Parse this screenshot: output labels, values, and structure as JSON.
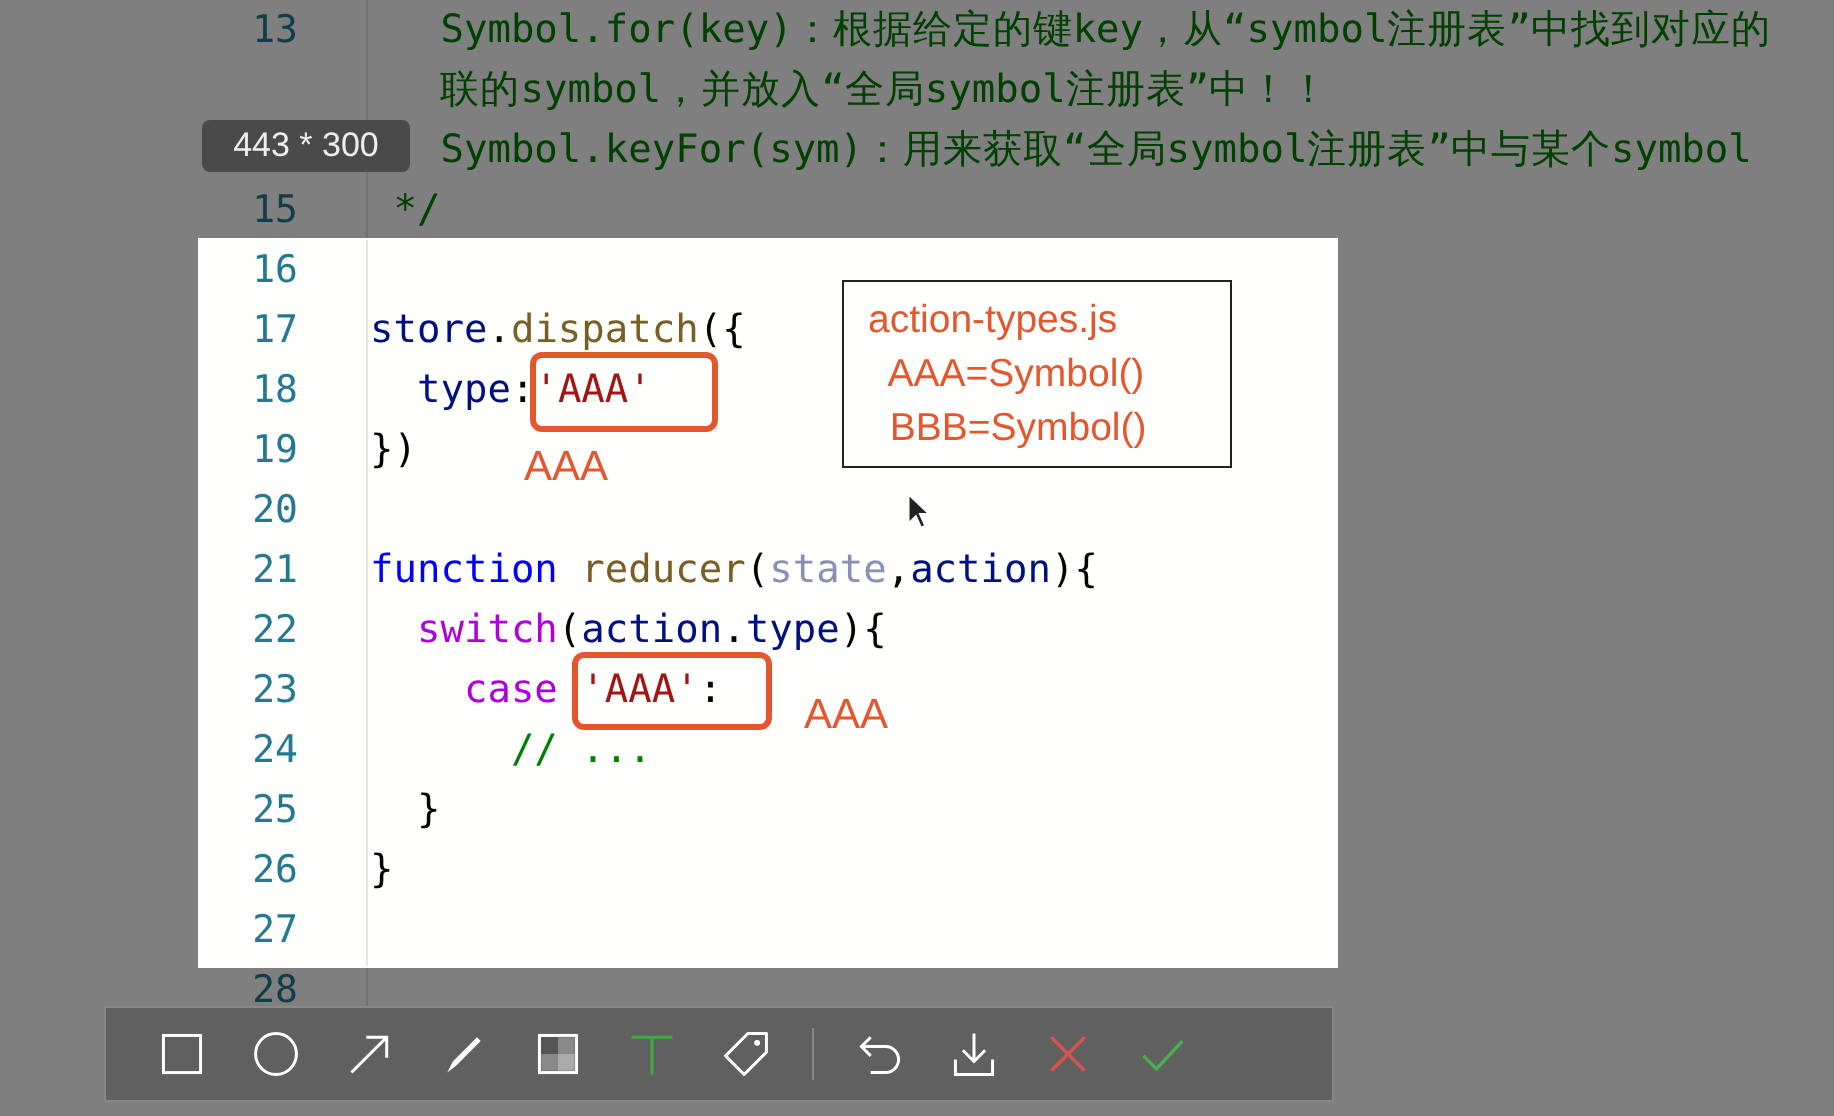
{
  "editor": {
    "lines": [
      {
        "number": "13",
        "tokens": [
          {
            "text": "   Symbol.for(key)：根据给定的键key，从“symbol注册表”中找到对应的",
            "kind": "comment"
          }
        ]
      },
      {
        "tokens": [
          {
            "text": "   联的symbol，并放入“全局symbol注册表”中！！",
            "kind": "comment"
          }
        ]
      },
      {
        "tokens": [
          {
            "text": "   Symbol.keyFor(sym)：用来获取“全局symbol注册表”中与某个symbol",
            "kind": "comment"
          }
        ]
      },
      {
        "number": "15",
        "tokens": [
          {
            "text": " */",
            "kind": "comment"
          }
        ]
      },
      {
        "number": "16"
      },
      {
        "number": "17",
        "tokens": [
          {
            "text": "store",
            "kind": "variable"
          },
          {
            "text": ".",
            "kind": "plain"
          },
          {
            "text": "dispatch",
            "kind": "function"
          },
          {
            "text": "({",
            "kind": "plain"
          }
        ]
      },
      {
        "number": "18",
        "tokens": [
          {
            "text": "  type",
            "kind": "variable"
          },
          {
            "text": ":",
            "kind": "plain"
          },
          {
            "text": "'AAA'",
            "kind": "string"
          }
        ]
      },
      {
        "number": "19",
        "tokens": [
          {
            "text": "})",
            "kind": "plain"
          }
        ]
      },
      {
        "number": "20"
      },
      {
        "number": "21",
        "tokens": [
          {
            "text": "function ",
            "kind": "keyword"
          },
          {
            "text": "reducer",
            "kind": "function"
          },
          {
            "text": "(",
            "kind": "plain"
          },
          {
            "text": "state",
            "kind": "unused"
          },
          {
            "text": ",",
            "kind": "plain"
          },
          {
            "text": "action",
            "kind": "variable"
          },
          {
            "text": "){",
            "kind": "plain"
          }
        ]
      },
      {
        "number": "22",
        "tokens": [
          {
            "text": "  switch",
            "kind": "control"
          },
          {
            "text": "(",
            "kind": "plain"
          },
          {
            "text": "action",
            "kind": "variable"
          },
          {
            "text": ".",
            "kind": "plain"
          },
          {
            "text": "type",
            "kind": "variable"
          },
          {
            "text": "){",
            "kind": "plain"
          }
        ]
      },
      {
        "number": "23",
        "tokens": [
          {
            "text": "    case ",
            "kind": "control"
          },
          {
            "text": "'AAA'",
            "kind": "string"
          },
          {
            "text": ":",
            "kind": "plain"
          }
        ]
      },
      {
        "number": "24",
        "tokens": [
          {
            "text": "      // ...",
            "kind": "comment"
          }
        ]
      },
      {
        "number": "25",
        "tokens": [
          {
            "text": "  }",
            "kind": "plain"
          }
        ]
      },
      {
        "number": "26",
        "tokens": [
          {
            "text": "}",
            "kind": "plain"
          }
        ]
      },
      {
        "number": "27"
      },
      {
        "number": "28"
      }
    ]
  },
  "selection": {
    "size_label": "443 * 300"
  },
  "annotations": [
    {
      "kind": "highlight"
    },
    {
      "kind": "label",
      "text": "AAA"
    },
    {
      "kind": "highlight"
    },
    {
      "kind": "label",
      "text": "AAA"
    },
    {
      "kind": "note",
      "lines": [
        "action-types.js",
        "  AAA=Symbol()",
        "  BBB=Symbol()"
      ]
    }
  ],
  "toolbar": {
    "tools": [
      {
        "kind": "rectangle",
        "selected": false
      },
      {
        "kind": "ellipse",
        "selected": false
      },
      {
        "kind": "arrow",
        "selected": false
      },
      {
        "kind": "pen",
        "selected": false
      },
      {
        "kind": "mosaic",
        "selected": false
      },
      {
        "kind": "text",
        "selected": true
      },
      {
        "kind": "tag",
        "selected": false
      },
      {
        "kind": "separator"
      },
      {
        "kind": "undo"
      },
      {
        "kind": "save"
      },
      {
        "kind": "cancel"
      },
      {
        "kind": "confirm"
      }
    ]
  }
}
